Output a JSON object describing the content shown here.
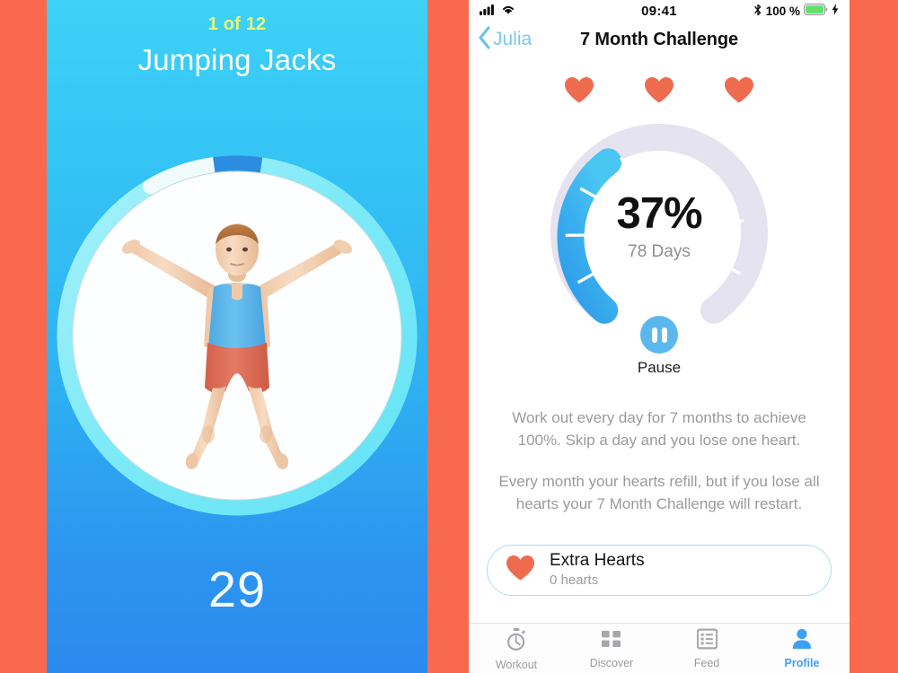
{
  "page": {
    "background_color": "#F8694E"
  },
  "workout_screen": {
    "counter": "1 of 12",
    "exercise_title": "Jumping Jacks",
    "reps": "29",
    "counter_color": "#E8F77A",
    "progress": {
      "percent": 8,
      "track_color": "#8FECF8",
      "fill_color": "#2C8DE0",
      "cap_color": "#EAF9FB"
    },
    "figure": {
      "icon": "jumping-jacks-figure",
      "shirt_color": "#57B4E8",
      "shorts_color": "#DE6A55",
      "skin_color": "#F3CFB0",
      "hair_color": "#B8713C"
    }
  },
  "challenge_screen": {
    "status_bar": {
      "signal_icon": "cellular-signal-icon",
      "wifi_icon": "wifi-icon",
      "time": "09:41",
      "bluetooth_icon": "bluetooth-icon",
      "battery_percent": "100 %",
      "battery_icon": "battery-full-icon",
      "charging_icon": "lightning-bolt-icon",
      "battery_color": "#5EE06B"
    },
    "nav_bar": {
      "back_icon": "chevron-left-icon",
      "back_label": "Julia",
      "title": "7 Month Challenge",
      "back_color": "#7FC9E8"
    },
    "hearts": {
      "icon": "heart-icon",
      "count": 3,
      "color": "#EE6B4F"
    },
    "gauge": {
      "percent_label": "37%",
      "days_label": "78 Days",
      "segments_total": 7,
      "segments_filled": 3,
      "fill_percent": 37,
      "fill_color_start": "#45C2F0",
      "fill_color_end": "#2E9BEA",
      "track_color": "#E4E3EF"
    },
    "pause": {
      "icon": "pause-icon",
      "label": "Pause",
      "color": "#5BB8EE"
    },
    "description": {
      "paragraph_1": "Work out every day for 7 months to achieve 100%. Skip a day and you lose one heart.",
      "paragraph_2": "Every month your hearts refill, but if you lose all hearts your 7 Month Challenge will restart."
    },
    "extra_hearts_card": {
      "icon": "heart-icon",
      "title": "Extra Hearts",
      "subtitle": "0 hearts",
      "border_color": "#AEDCF0"
    },
    "tab_bar": {
      "tabs": [
        {
          "icon": "stopwatch-icon",
          "label": "Workout",
          "active": false
        },
        {
          "icon": "grid-icon",
          "label": "Discover",
          "active": false
        },
        {
          "icon": "list-icon",
          "label": "Feed",
          "active": false
        },
        {
          "icon": "person-icon",
          "label": "Profile",
          "active": true
        }
      ],
      "active_color": "#3DA0F5",
      "inactive_color": "#9C9CA1"
    }
  }
}
